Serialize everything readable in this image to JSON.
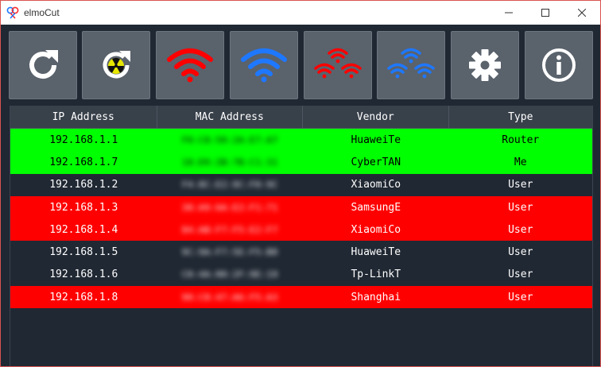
{
  "window": {
    "title": "elmoCut",
    "accent_border": "#d9534f"
  },
  "toolbar": {
    "buttons": [
      {
        "name": "refresh",
        "icon": "refresh-icon"
      },
      {
        "name": "scan",
        "icon": "radiation-scan-icon"
      },
      {
        "name": "kill",
        "icon": "wifi-red-icon"
      },
      {
        "name": "unkill",
        "icon": "wifi-blue-icon"
      },
      {
        "name": "kill-all",
        "icon": "multi-wifi-red-icon"
      },
      {
        "name": "unkill-all",
        "icon": "multi-wifi-blue-icon"
      },
      {
        "name": "settings",
        "icon": "gear-icon"
      },
      {
        "name": "about",
        "icon": "info-icon"
      }
    ]
  },
  "table": {
    "headers": [
      "IP Address",
      "MAC Address",
      "Vendor",
      "Type"
    ],
    "rows": [
      {
        "ip": "192.168.1.1",
        "mac": "F0:C8:50:2A:E7:A7",
        "vendor": "HuaweiTe",
        "type": "Router",
        "status": "router"
      },
      {
        "ip": "192.168.1.7",
        "mac": "18:D9:2B:7B:C1:31",
        "vendor": "CyberTAN",
        "type": "Me",
        "status": "me"
      },
      {
        "ip": "192.168.1.2",
        "mac": "F4:8C:E2:9C:F0:9C",
        "vendor": "XiaomiCo",
        "type": "User",
        "status": "normal"
      },
      {
        "ip": "192.168.1.3",
        "mac": "38:A9:6A:E2:F1:71",
        "vendor": "SamsungE",
        "type": "User",
        "status": "killed"
      },
      {
        "ip": "192.168.1.4",
        "mac": "84:AB:F7:F5:E2:F7",
        "vendor": "XiaomiCo",
        "type": "User",
        "status": "killed"
      },
      {
        "ip": "192.168.1.5",
        "mac": "9C:9A:F7:5E:F5:B0",
        "vendor": "HuaweiTe",
        "type": "User",
        "status": "normal"
      },
      {
        "ip": "192.168.1.6",
        "mac": "C0:4A:00:2F:9E:19",
        "vendor": "Tp-LinkT",
        "type": "User",
        "status": "normal"
      },
      {
        "ip": "192.168.1.8",
        "mac": "90:C8:47:A6:F5:A3",
        "vendor": "Shanghai",
        "type": "User",
        "status": "killed"
      }
    ]
  },
  "colors": {
    "router_me": "#00ff00",
    "killed": "#ff0000",
    "normal": "#202833",
    "normal_text": "#ffffff",
    "highlight_text": "#000000",
    "wifi_red": "#ff0000",
    "wifi_blue": "#1e78ff"
  }
}
